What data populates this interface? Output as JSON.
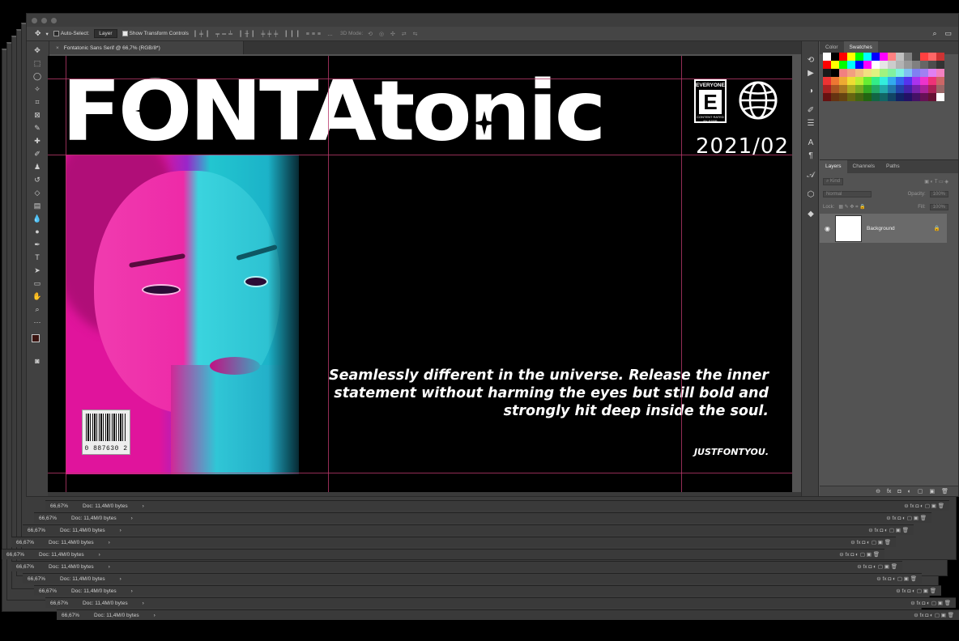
{
  "window": {
    "document_tab": "Fontatonic Sans Serif @ 66,7% (RGB/8*)",
    "close_icon": "close-icon"
  },
  "options_bar": {
    "auto_select_label": "Auto-Select:",
    "auto_select_value": "Layer",
    "transform_label": "Show Transform Controls",
    "mode_3d_label": "3D Mode:"
  },
  "artwork": {
    "masthead": "FONTAtonic",
    "rating_top": "EVERYONE",
    "rating_letter": "E",
    "rating_bottom": "CONTENT RATED BY ESRB",
    "issue_date": "2021/02",
    "tagline": "Seamlessly different in the universe. Release the inner statement without harming the eyes but still bold and strongly hit deep inside the soul.",
    "brand": "JUSTFONTYOU.",
    "barcode_number": "0  887630  2"
  },
  "panels": {
    "tab_color": "Color",
    "tab_swatches": "Swatches",
    "tab_layers": "Layers",
    "tab_channels": "Channels",
    "tab_paths": "Paths",
    "filter_kind": "Kind",
    "blend_mode": "Normal",
    "opacity_label": "Opacity:",
    "opacity_value": "100%",
    "lock_label": "Lock:",
    "fill_label": "Fill:",
    "fill_value": "100%",
    "layer_name": "Background"
  },
  "status": {
    "zoom": "66,67%",
    "doc_size": "Doc: 11,4M/0 bytes"
  },
  "swatches": [
    "#ffffff",
    "#000000",
    "#ff0000",
    "#ffff00",
    "#00ff00",
    "#00ffff",
    "#0000ff",
    "#ff00ff",
    "#ff8080",
    "#c0c0c0",
    "#808080",
    "#404040",
    "#ff4040",
    "#ff6666",
    "#cc3333",
    "#ff0000",
    "#ffff00",
    "#00ff00",
    "#00ffff",
    "#0000ff",
    "#ff00ff",
    "#ffffff",
    "#e6e6e6",
    "#cccccc",
    "#b3b3b3",
    "#999999",
    "#808080",
    "#666666",
    "#4d4d4d",
    "#333333",
    "#1a1a1a",
    "#000000",
    "#f28080",
    "#f2a080",
    "#f2c080",
    "#f2e080",
    "#e0f280",
    "#a0f280",
    "#80f2a0",
    "#80f2e0",
    "#80c0f2",
    "#8080f2",
    "#a080f2",
    "#e080f2",
    "#f280c0",
    "#ee3333",
    "#ee7733",
    "#eeaa33",
    "#eedd33",
    "#bbee33",
    "#66ee33",
    "#33ee88",
    "#33eedd",
    "#33aaee",
    "#3366ee",
    "#5533ee",
    "#aa33ee",
    "#ee33cc",
    "#ee3377",
    "#cc6666",
    "#aa2222",
    "#aa5522",
    "#aa7722",
    "#aaaa22",
    "#77aa22",
    "#33aa22",
    "#22aa66",
    "#22aaaa",
    "#2277aa",
    "#2244aa",
    "#4422aa",
    "#7722aa",
    "#aa2299",
    "#aa2255",
    "#996666",
    "#661111",
    "#663311",
    "#664411",
    "#666611",
    "#446611",
    "#226611",
    "#116644",
    "#116666",
    "#114466",
    "#112266",
    "#221166",
    "#441166",
    "#661155",
    "#661133",
    "#ffffff"
  ]
}
